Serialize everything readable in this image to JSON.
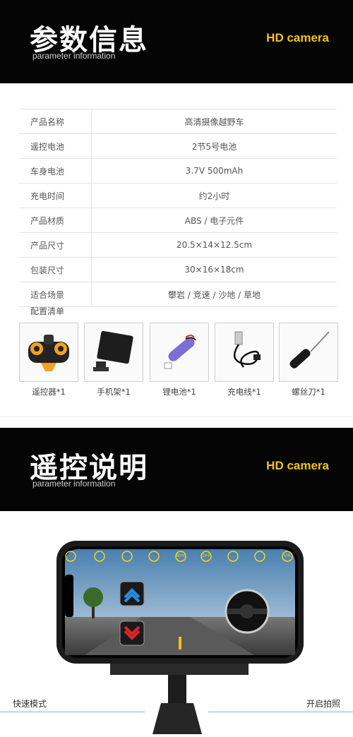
{
  "section1": {
    "title": "参数信息",
    "subtitle": "parameter information",
    "badge": "HD camera"
  },
  "specs": [
    {
      "key": "产品名称",
      "value": "高清摄像越野车"
    },
    {
      "key": "遥控电池",
      "value": "2节5号电池"
    },
    {
      "key": "车身电池",
      "value": "3.7V 500mAh"
    },
    {
      "key": "充电时间",
      "value": "约2小时"
    },
    {
      "key": "产品材质",
      "value": "ABS / 电子元件"
    },
    {
      "key": "产品尺寸",
      "value": "20.5×14×12.5cm"
    },
    {
      "key": "包装尺寸",
      "value": "30×16×18cm"
    },
    {
      "key": "适合场景",
      "value": "攀岩 / 竞速 / 沙地 / 草地"
    }
  ],
  "config": {
    "title": "配置清单",
    "items": [
      {
        "label": "遥控器*1",
        "icon": "remote-controller-icon"
      },
      {
        "label": "手机架*1",
        "icon": "phone-holder-icon"
      },
      {
        "label": "锂电池*1",
        "icon": "lithium-battery-icon"
      },
      {
        "label": "充电线*1",
        "icon": "charging-cable-icon"
      },
      {
        "label": "螺丝刀*1",
        "icon": "screwdriver-icon"
      }
    ]
  },
  "section2": {
    "title": "遥控说明",
    "subtitle": "parameter information",
    "badge": "HD camera"
  },
  "app": {
    "toolbar_icons": [
      "back-icon",
      "camera-icon",
      "video-icon",
      "record-icon",
      "percent-icon",
      "off-icon",
      "gravity-icon",
      "screen-icon",
      "vr-icon"
    ],
    "toolbar_text": {
      "percent": "60%",
      "off": "OFF",
      "vr": "VR"
    },
    "colors": {
      "accent": "#f3d21a",
      "up_arrow": "#2b8ddc",
      "down_arrow": "#d8262b"
    }
  },
  "labels": {
    "left": "快速模式",
    "right": "开启拍照"
  }
}
